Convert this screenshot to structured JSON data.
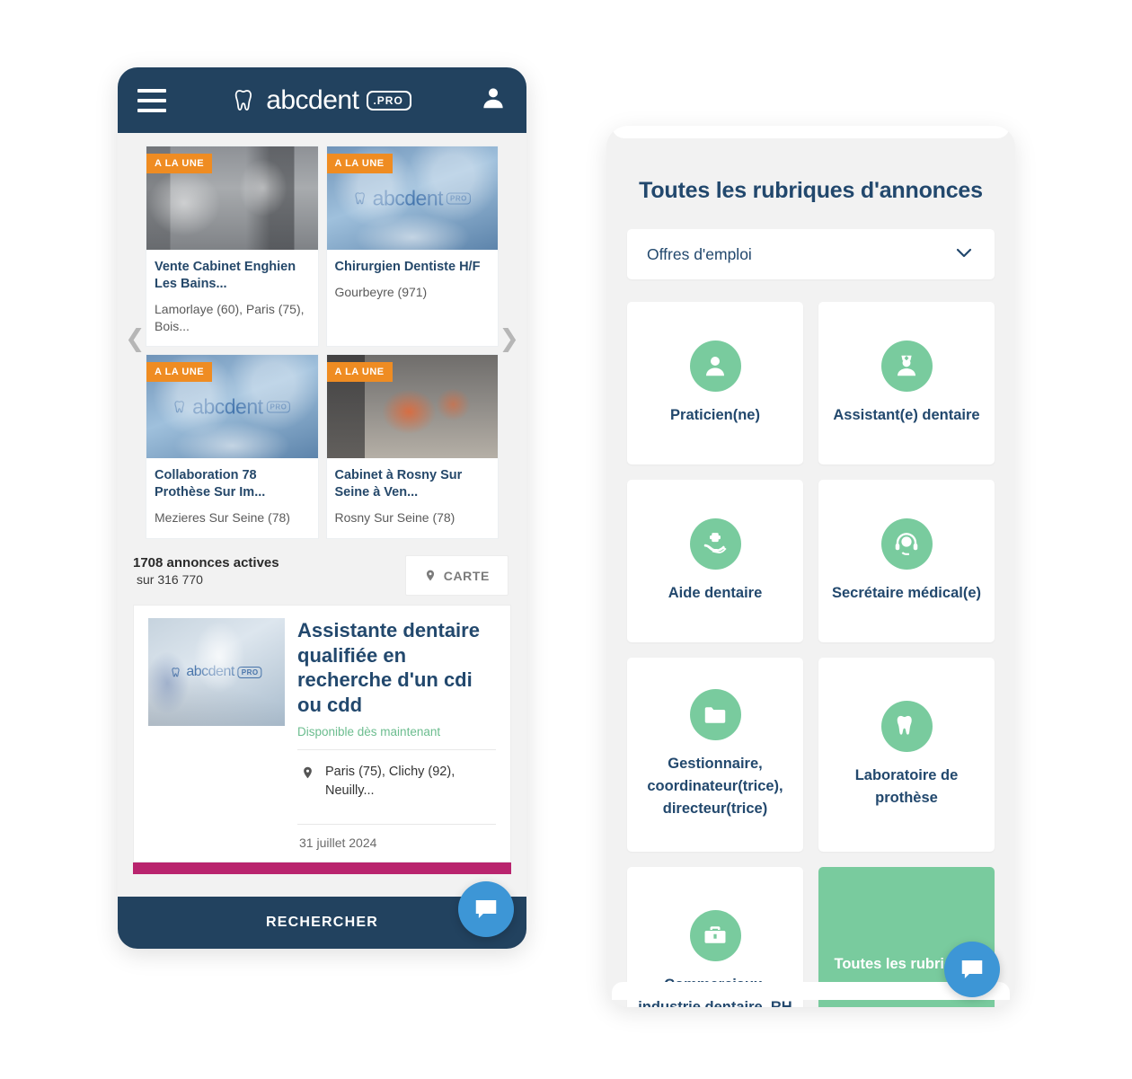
{
  "left_phone": {
    "header": {
      "menu_icon": "hamburger-menu-icon",
      "brand_name": "abcdent",
      "brand_suffix": ".PRO",
      "account_icon": "user-account-icon"
    },
    "carousel": {
      "prev_icon": "chevron-left-icon",
      "next_icon": "chevron-right-icon",
      "badge_label": "A LA UNE",
      "cards": [
        {
          "title": "Vente Cabinet Enghien Les Bains...",
          "location": "Lamorlaye (60), Paris (75), Bois...",
          "image": "dental-office-photo"
        },
        {
          "title": "Chirurgien Dentiste H/F",
          "location": "Gourbeyre (971)",
          "image": "surgery-team-photo"
        },
        {
          "title": "Collaboration 78 Prothèse Sur Im...",
          "location": "Mezieres Sur Seine (78)",
          "image": "surgery-team-photo"
        },
        {
          "title": "Cabinet à Rosny Sur Seine à Ven...",
          "location": "Rosny Sur Seine (78)",
          "image": "dental-chair-photo"
        }
      ]
    },
    "stats": {
      "active_count": "1708 annonces actives",
      "total_count": "sur 316 770",
      "map_button_label": "CARTE",
      "map_icon": "map-pin-icon"
    },
    "listing": {
      "image": "dental-clinic-photo",
      "title": "Assistante dentaire qualifiée en recherche d'un cdi ou cdd",
      "availability": "Disponible dès maintenant",
      "location_icon": "map-pin-icon",
      "location": "Paris (75), Clichy (92), Neuilly...",
      "date": "31 juillet 2024"
    },
    "search_button_label": "RECHERCHER",
    "chat_icon": "chat-bubble-icon"
  },
  "right_phone": {
    "title": "Toutes les rubriques d'annonces",
    "select": {
      "value": "Offres d'emploi",
      "chevron_icon": "chevron-down-icon"
    },
    "categories": [
      {
        "label": "Praticien(ne)",
        "icon": "person-icon"
      },
      {
        "label": "Assistant(e) dentaire",
        "icon": "nurse-icon"
      },
      {
        "label": "Aide dentaire",
        "icon": "hand-cross-icon"
      },
      {
        "label": "Secrétaire médical(e)",
        "icon": "headset-icon"
      },
      {
        "label": "Gestionnaire, coordinateur(trice), directeur(trice)",
        "icon": "folder-icon"
      },
      {
        "label": "Laboratoire de prothèse",
        "icon": "tooth-icon"
      },
      {
        "label": "Commerciaux, industrie dentaire, RH",
        "icon": "briefcase-icon"
      }
    ],
    "all_categories_label": "Toutes les rubriques",
    "chat_icon": "chat-bubble-icon"
  },
  "colors": {
    "navy": "#22425f",
    "title_blue": "#22486d",
    "orange_badge": "#ef8c22",
    "green_accent": "#79cb9e",
    "magenta_bar": "#b9246e",
    "chat_blue": "#3d96d6",
    "page_bg": "#f2f2f2"
  }
}
